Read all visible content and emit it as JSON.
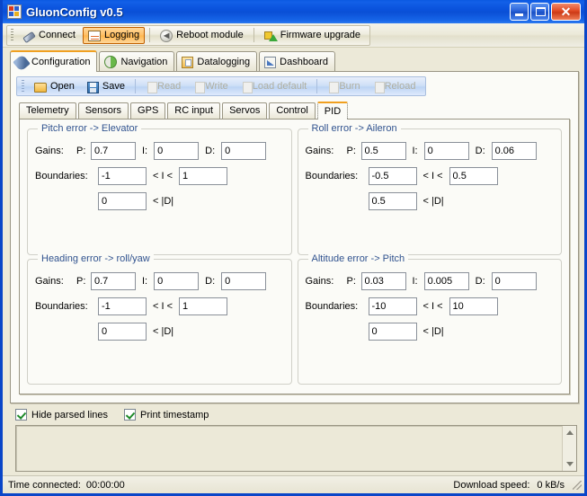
{
  "window": {
    "title": "GluonConfig v0.5",
    "icon": "app-grid-icon",
    "controls": {
      "minimize": "Minimize",
      "maximize": "Maximize",
      "close": "Close"
    }
  },
  "main_toolbar": {
    "buttons": [
      {
        "label": "Connect",
        "icon": "plug-icon",
        "state": "normal"
      },
      {
        "label": "Logging",
        "icon": "log-window-icon",
        "state": "active"
      },
      {
        "label": "Reboot module",
        "icon": "reboot-circle-icon",
        "state": "normal"
      },
      {
        "label": "Firmware upgrade",
        "icon": "firmware-arrow-icon",
        "state": "normal"
      }
    ]
  },
  "outer_tabs": [
    {
      "label": "Configuration",
      "icon": "wrench-icon",
      "selected": true
    },
    {
      "label": "Navigation",
      "icon": "compass-icon",
      "selected": false
    },
    {
      "label": "Datalogging",
      "icon": "datalog-icon",
      "selected": false
    },
    {
      "label": "Dashboard",
      "icon": "dashboard-icon",
      "selected": false
    }
  ],
  "file_toolbar": {
    "buttons": [
      {
        "label": "Open",
        "icon": "open-folder-icon",
        "enabled": true
      },
      {
        "label": "Save",
        "icon": "floppy-save-icon",
        "enabled": true
      },
      {
        "label": "Read",
        "icon": "read-doc-icon",
        "enabled": false
      },
      {
        "label": "Write",
        "icon": "write-doc-icon",
        "enabled": false
      },
      {
        "label": "Load default",
        "icon": "load-default-icon",
        "enabled": false
      },
      {
        "label": "Burn",
        "icon": "burn-doc-icon",
        "enabled": false
      },
      {
        "label": "Reload",
        "icon": "reload-doc-icon",
        "enabled": false
      }
    ]
  },
  "inner_tabs": [
    {
      "label": "Telemetry",
      "selected": false
    },
    {
      "label": "Sensors",
      "selected": false
    },
    {
      "label": "GPS",
      "selected": false
    },
    {
      "label": "RC input",
      "selected": false
    },
    {
      "label": "Servos",
      "selected": false
    },
    {
      "label": "Control",
      "selected": false
    },
    {
      "label": "PID",
      "selected": true
    }
  ],
  "labels": {
    "gains": "Gains:",
    "boundaries": "Boundaries:",
    "p": "P:",
    "i": "I:",
    "d": "D:",
    "integral_op": "< I <",
    "derivative_op": "< |D|"
  },
  "pid_panels": [
    {
      "title": "Pitch error -> Elevator",
      "p": "0.7",
      "i": "0",
      "d": "0",
      "i_min": "-1",
      "i_max": "1",
      "d_min": "0"
    },
    {
      "title": "Roll error -> Aileron",
      "p": "0.5",
      "i": "0",
      "d": "0.06",
      "i_min": "-0.5",
      "i_max": "0.5",
      "d_min": "0.5"
    },
    {
      "title": "Heading error -> roll/yaw",
      "p": "0.7",
      "i": "0",
      "d": "0",
      "i_min": "-1",
      "i_max": "1",
      "d_min": "0"
    },
    {
      "title": "Altitude error -> Pitch",
      "p": "0.03",
      "i": "0.005",
      "d": "0",
      "i_min": "-10",
      "i_max": "10",
      "d_min": "0"
    }
  ],
  "bottom_options": {
    "hide_parsed_lines": {
      "label": "Hide parsed lines",
      "checked": true
    },
    "print_timestamp": {
      "label": "Print timestamp",
      "checked": true
    },
    "log_output": ""
  },
  "status_bar": {
    "time_connected_label": "Time connected:",
    "time_connected_value": "00:00:00",
    "download_speed_label": "Download speed:",
    "download_speed_value": "0 kB/s"
  },
  "colors": {
    "titlebar_blue": "#0a52dc",
    "window_border": "#0a46c8",
    "face": "#ece9d8",
    "group_title": "#31538f",
    "tab_accent": "#f0a020",
    "active_button": "#ffbf63",
    "check_green": "#1d8a28"
  }
}
